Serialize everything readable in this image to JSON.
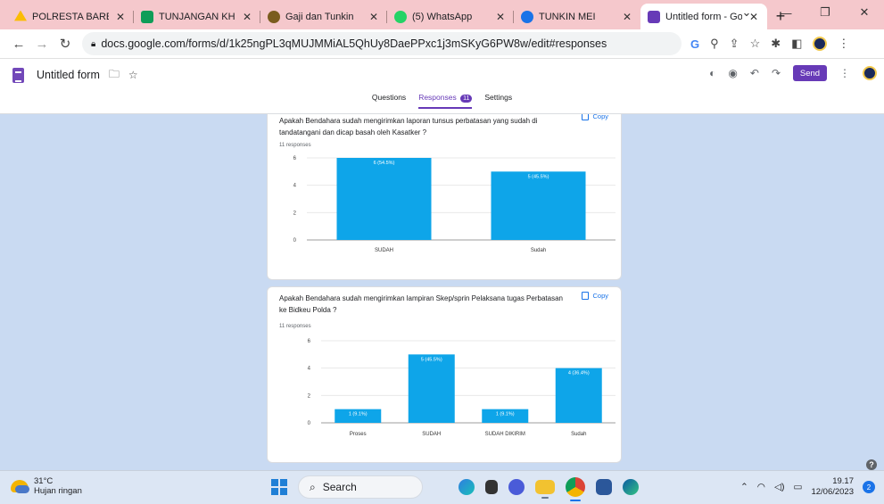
{
  "browser": {
    "tabs": [
      {
        "title": "POLRESTA BARELA",
        "color": "#fbbc04"
      },
      {
        "title": "TUNJANGAN KHUS",
        "color": "#0f9d58"
      },
      {
        "title": "Gaji dan Tunkin",
        "color": "#7a5c1e"
      },
      {
        "title": "(5) WhatsApp",
        "color": "#25d366"
      },
      {
        "title": "TUNKIN MEI",
        "color": "#1a73e8"
      },
      {
        "title": "Untitled form - Goo",
        "color": "#673ab7"
      }
    ],
    "url": "docs.google.com/forms/d/1k25ngPL3qMUJMMiAL5QhUy8DaePPxc1j3mSKyG6PW8w/edit#responses"
  },
  "form": {
    "title": "Untitled form",
    "send_label": "Send",
    "tabs": {
      "questions": "Questions",
      "responses": "Responses",
      "responses_count": "11",
      "settings": "Settings"
    }
  },
  "copy_label": "Copy",
  "questions": [
    {
      "text": "Apakah Bendahara sudah mengirimkan laporan tunsus perbatasan yang sudah di tandatangani dan dicap basah oleh Kasatker ?",
      "responses": "11 responses"
    },
    {
      "text": "Apakah Bendahara sudah mengirimkan lampiran Skep/sprin Pelaksana tugas Perbatasan ke Bidkeu Polda ?",
      "responses": "11 responses"
    }
  ],
  "chart_data": [
    {
      "type": "bar",
      "categories": [
        "SUDAH",
        "Sudah"
      ],
      "values": [
        6,
        5
      ],
      "labels": [
        "6 (54.5%)",
        "5 (45.5%)"
      ],
      "yticks": [
        "0",
        "2",
        "4",
        "6"
      ],
      "ylim": [
        0,
        6
      ],
      "color": "#0ea5e9"
    },
    {
      "type": "bar",
      "categories": [
        "Proses",
        "SUDAH",
        "SUDAH DIKIRIM",
        "Sudah"
      ],
      "values": [
        1,
        5,
        1,
        4
      ],
      "labels": [
        "1 (9.1%)",
        "5 (45.5%)",
        "1 (9.1%)",
        "4 (36.4%)"
      ],
      "yticks": [
        "0",
        "2",
        "4",
        "6"
      ],
      "ylim": [
        0,
        6
      ],
      "color": "#0ea5e9"
    }
  ],
  "taskbar": {
    "temp": "31°C",
    "weather": "Hujan ringan",
    "search": "Search",
    "time": "19.17",
    "date": "12/06/2023",
    "notif": "2"
  }
}
